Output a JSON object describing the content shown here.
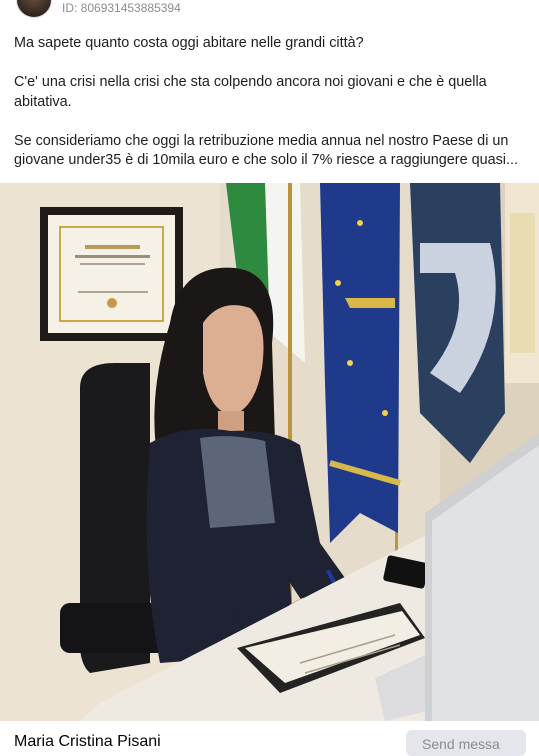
{
  "post": {
    "id_text": "ID: 806931453885394",
    "paragraphs": [
      "Ma sapete quanto costa oggi abitare nelle grandi città?",
      "C'e' una crisi nella crisi che sta colpendo ancora noi giovani e che è quella abitativa.",
      "Se consideriamo che oggi la retribuzione media annua nel nostro Paese di un giovane under35 è di 10mila euro e che solo il 7% riesce a raggiungere quasi..."
    ]
  },
  "footer": {
    "author_name": "Maria Cristina Pisani",
    "send_label": "Send messa"
  }
}
